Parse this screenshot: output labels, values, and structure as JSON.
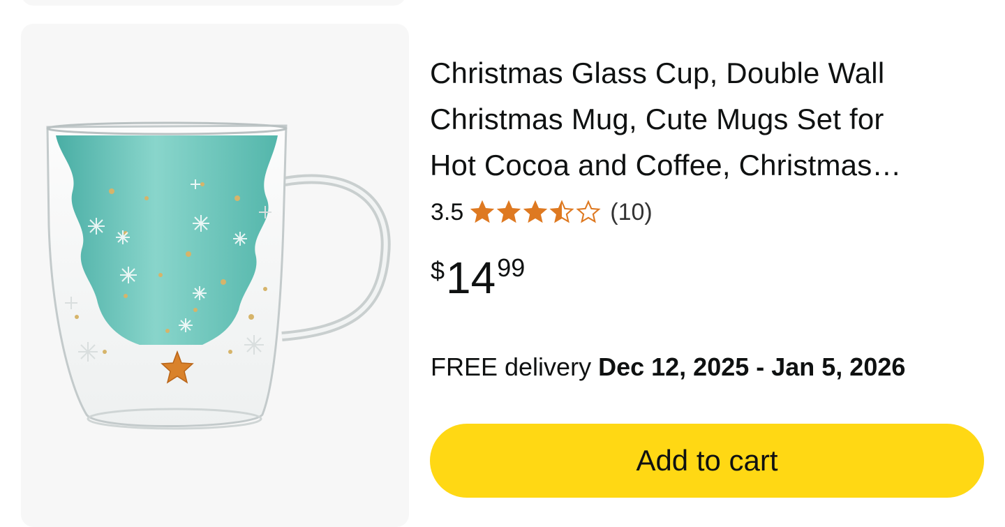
{
  "product": {
    "title_lines": [
      "Christmas Glass Cup, Double Wall",
      "Christmas Mug, Cute Mugs Set for",
      "Hot Cocoa and Coffee, Christmas…"
    ],
    "rating": "3.5",
    "rating_stars": 3.5,
    "review_count": "(10)",
    "price": {
      "currency": "$",
      "whole": "14",
      "fraction": "99"
    },
    "delivery": {
      "prefix": "FREE delivery",
      "dates": "Dec 12, 2025 - Jan 5, 2026"
    },
    "image_icon": "christmas-tree-glass-mug"
  },
  "actions": {
    "add_to_cart_label": "Add to cart"
  },
  "colors": {
    "button": "#ffd814",
    "star": "#de7921",
    "text": "#0f1111",
    "card_bg": "#f7f7f7"
  }
}
